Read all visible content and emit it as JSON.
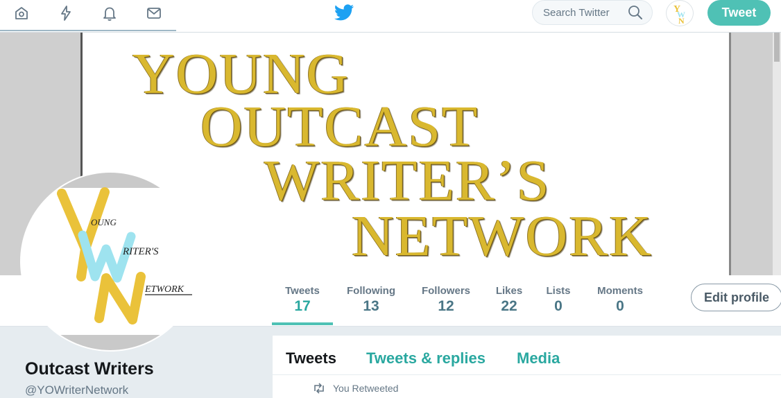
{
  "nav": {
    "icons": [
      "home-icon",
      "moments-icon",
      "notifications-icon",
      "messages-icon"
    ],
    "logo": "twitter-bird-icon",
    "search_placeholder": "Search Twitter",
    "tweet_button": "Tweet"
  },
  "banner": {
    "lines": [
      "YOUNG",
      "OUTCAST",
      "WRITER’S",
      "NETWORK"
    ]
  },
  "avatar": {
    "lettering": [
      "Y",
      "OUNG",
      "W",
      "RITER'S",
      "N",
      "ETWORK"
    ]
  },
  "stats": [
    {
      "label": "Tweets",
      "value": "17"
    },
    {
      "label": "Following",
      "value": "13"
    },
    {
      "label": "Followers",
      "value": "12"
    },
    {
      "label": "Likes",
      "value": "22"
    },
    {
      "label": "Lists",
      "value": "0"
    },
    {
      "label": "Moments",
      "value": "0"
    }
  ],
  "edit_profile": "Edit profile",
  "profile": {
    "name": "Outcast Writers",
    "handle": "@YOWriterNetwork"
  },
  "timeline": {
    "tabs": [
      "Tweets",
      "Tweets & replies",
      "Media"
    ],
    "retweet_context": "You Retweeted"
  },
  "colors": {
    "accent": "#4fc1b5",
    "banner_gold": "#d9b82f",
    "avatar_yellow": "#eac23a",
    "avatar_blue": "#9ee3ef"
  }
}
